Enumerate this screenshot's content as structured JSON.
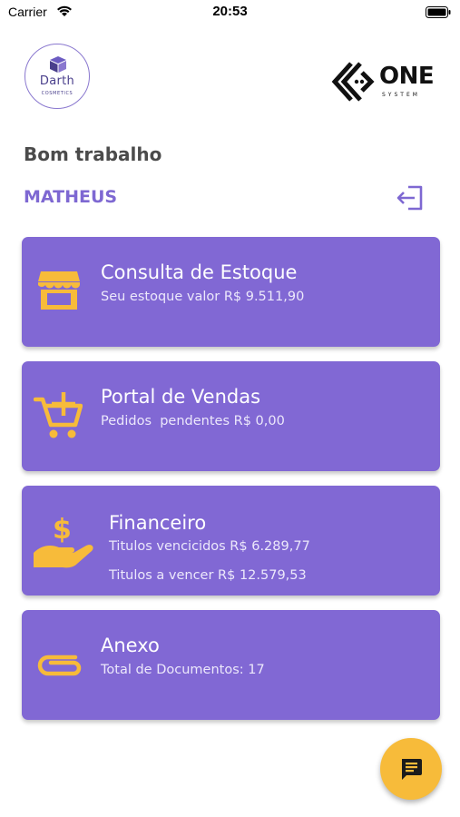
{
  "status_bar": {
    "carrier": "Carrier",
    "time": "20:53"
  },
  "logos": {
    "left": {
      "brand": "Darth",
      "sub": "COSMETICS"
    },
    "right": {
      "brand": "ONE",
      "sub": "SYSTEM"
    }
  },
  "greeting": "Bom trabalho",
  "user": {
    "name": "MATHEUS"
  },
  "cards": {
    "estoque": {
      "title": "Consulta de Estoque",
      "subtitle": "Seu estoque valor R$ 9.511,90",
      "icon": "store-icon"
    },
    "vendas": {
      "title": "Portal de Vendas",
      "subtitle": "Pedidos  pendentes R$ 0,00",
      "icon": "add-cart-icon"
    },
    "financeiro": {
      "title": "Financeiro",
      "sub1": "Titulos vencicidos R$ 6.289,77",
      "sub2": "Titulos a vencer R$ 12.579,53",
      "icon": "money-hand-icon"
    },
    "anexo": {
      "title": "Anexo",
      "subtitle": "Total de Documentos: 17",
      "icon": "paperclip-icon"
    }
  },
  "colors": {
    "accent": "#7e68d2",
    "card": "#8168d4",
    "icon": "#f7bb3a",
    "fab": "#f7bb3a"
  },
  "fab": {
    "icon": "chat-icon"
  }
}
